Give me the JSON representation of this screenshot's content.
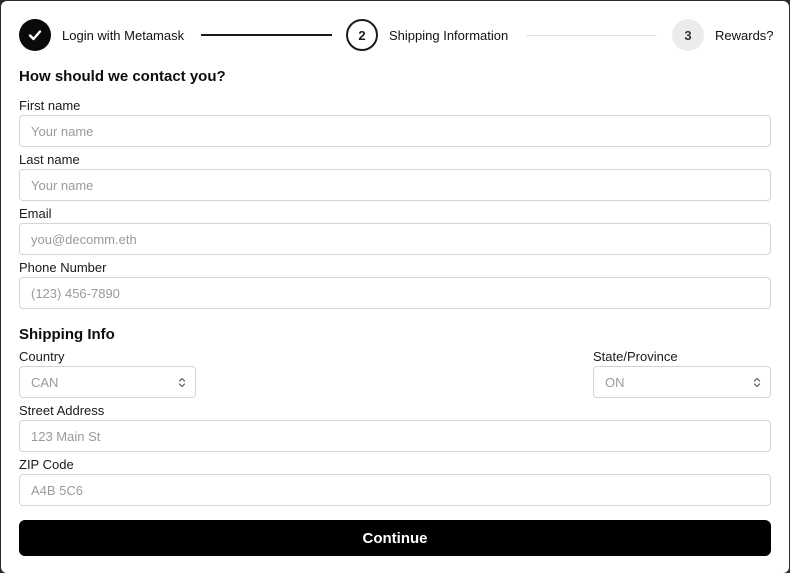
{
  "stepper": {
    "steps": [
      {
        "label": "Login with Metamask",
        "state": "done",
        "number": ""
      },
      {
        "label": "Shipping Information",
        "state": "current",
        "number": "2"
      },
      {
        "label": "Rewards?",
        "state": "todo",
        "number": "3"
      }
    ]
  },
  "contact": {
    "title": "How should we contact you?",
    "first_name": {
      "label": "First name",
      "placeholder": "Your name",
      "value": ""
    },
    "last_name": {
      "label": "Last name",
      "placeholder": "Your name",
      "value": ""
    },
    "email": {
      "label": "Email",
      "placeholder": "you@decomm.eth",
      "value": ""
    },
    "phone": {
      "label": "Phone Number",
      "placeholder": "(123) 456-7890",
      "value": ""
    }
  },
  "shipping": {
    "title": "Shipping Info",
    "country": {
      "label": "Country",
      "selected": "CAN"
    },
    "state": {
      "label": "State/Province",
      "selected": "ON"
    },
    "street": {
      "label": "Street Address",
      "placeholder": "123 Main St",
      "value": ""
    },
    "zip": {
      "label": "ZIP Code",
      "placeholder": "A4B 5C6",
      "value": ""
    }
  },
  "actions": {
    "continue_label": "Continue"
  },
  "colors": {
    "primary": "#000000",
    "border": "#d4d4d4",
    "placeholder": "#9a9a9a"
  }
}
